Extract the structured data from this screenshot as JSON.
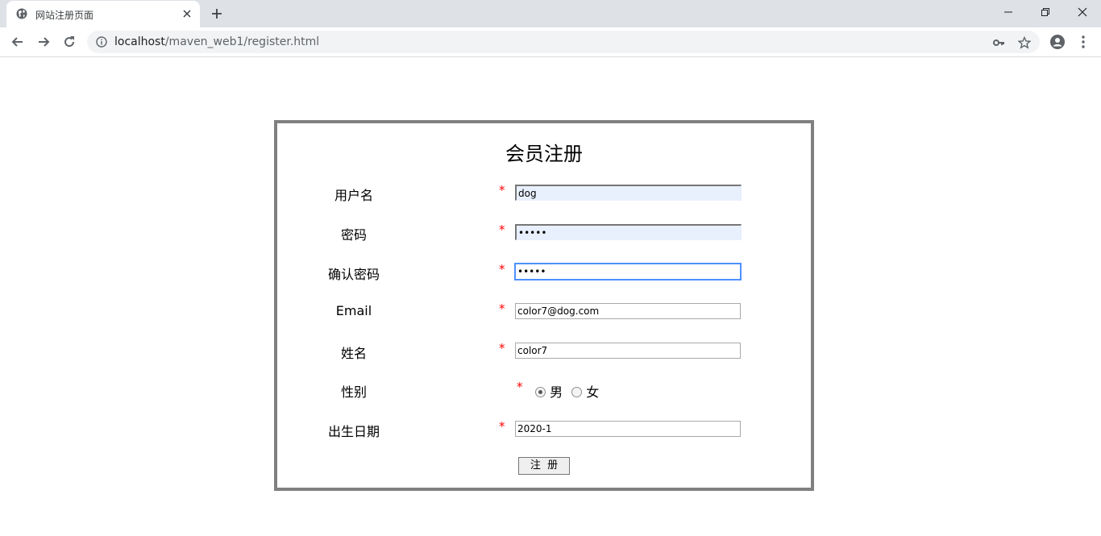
{
  "browser": {
    "tab_title": "网站注册页面",
    "url_host": "localhost",
    "url_path": "/maven_web1/register.html"
  },
  "form": {
    "title": "会员注册",
    "required_mark": "*",
    "username": {
      "label": "用户名",
      "value": "dog"
    },
    "password": {
      "label": "密码",
      "value": "•••••"
    },
    "confirm_password": {
      "label": "确认密码",
      "value": "•••••"
    },
    "email": {
      "label": "Email",
      "value": "color7@dog.com"
    },
    "name": {
      "label": "姓名",
      "value": "color7"
    },
    "gender": {
      "label": "性别",
      "options": [
        "男",
        "女"
      ],
      "selected": "男"
    },
    "birthday": {
      "label": "出生日期",
      "value": "2020-1"
    },
    "submit_label": "注  册"
  }
}
